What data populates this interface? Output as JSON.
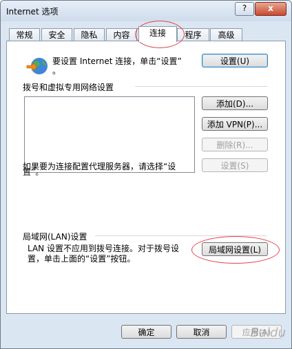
{
  "window": {
    "title": "Internet 选项",
    "help_label": "?",
    "close_label": "x"
  },
  "tabs": [
    {
      "label": "常规"
    },
    {
      "label": "安全"
    },
    {
      "label": "隐私"
    },
    {
      "label": "内容"
    },
    {
      "label": "连接"
    },
    {
      "label": "程序"
    },
    {
      "label": "高级"
    }
  ],
  "connection": {
    "setup_text_1": "要设置 Internet 连接，单击“设置”",
    "setup_text_2": "。",
    "setup_button": "设置(U)",
    "dialup_group": "拨号和虚拟专用网络设置",
    "add_button": "添加(D)...",
    "add_vpn_button": "添加 VPN(P)...",
    "delete_button": "删除(R)...",
    "settings_button": "设置(S)",
    "proxy_text_1": "如果要为连接配置代理服务器，请选择“设",
    "proxy_text_2": "置”。",
    "lan_group": "局域网(LAN)设置",
    "lan_text_1": "LAN 设置不应用到拨号连接。对于拨号设",
    "lan_text_2": "置，单击上面的“设置”按钮。",
    "lan_button": "局域网设置(L)"
  },
  "footer": {
    "ok": "确定",
    "cancel": "取消",
    "apply": "应用(A)"
  },
  "watermark": "Baidu"
}
